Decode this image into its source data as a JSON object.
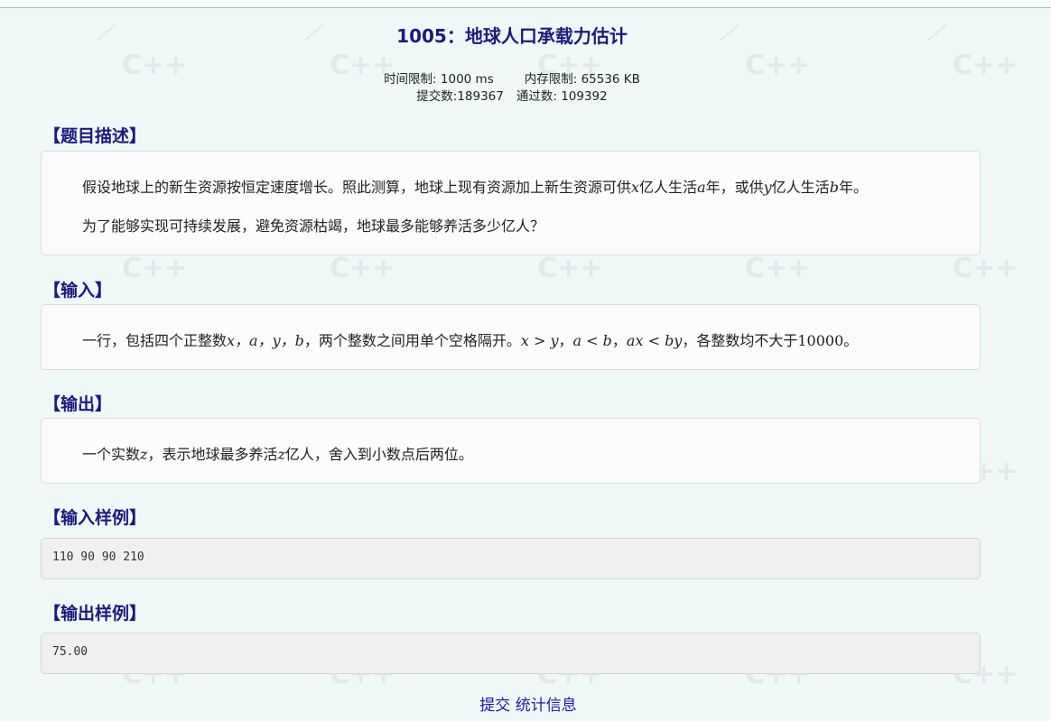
{
  "problem": {
    "title": "1005：地球人口承载力估计",
    "time_limit": "时间限制: 1000 ms",
    "memory_limit": "内存限制: 65536 KB",
    "submissions": "提交数:189367",
    "accepted": "通过数: 109392"
  },
  "sections": {
    "description_head": "【题目描述】",
    "description_line1": {
      "t1": "假设地球上的新生资源按恒定速度增长。照此测算，地球上现有资源加上新生资源可供",
      "x": "x",
      "t2": "亿人生活",
      "a": "a",
      "t3": "年，或供",
      "y": "y",
      "t4": "亿人生活",
      "b": "b",
      "t5": "年。"
    },
    "description_line2": "为了能够实现可持续发展，避免资源枯竭，地球最多能够养活多少亿人？",
    "input_head": "【输入】",
    "input_line": {
      "t1": "一行，包括四个正整数",
      "vars": "x，a，y，b",
      "t2": "，两个整数之间用单个空格隔开。",
      "c1": "x > y",
      "sep1": "，",
      "c2": "a < b",
      "sep2": "，",
      "c3": "ax < by",
      "t3": "，各整数均不大于",
      "max": "10000",
      "t4": "。"
    },
    "output_head": "【输出】",
    "output_line": {
      "t1": "一个实数",
      "z1": "z",
      "t2": "，表示地球最多养活",
      "z2": "z",
      "t3": "亿人，舍入到小数点后两位。"
    },
    "sample_input_head": "【输入样例】",
    "sample_input": "110 90 90 210",
    "sample_output_head": "【输出样例】",
    "sample_output": "75.00"
  },
  "footer": {
    "submit": "提交",
    "stats": "统计信息"
  },
  "watermark": {
    "text": "C++"
  }
}
